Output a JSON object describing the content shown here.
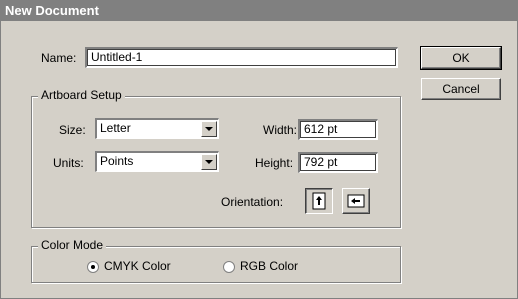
{
  "window": {
    "title": "New Document"
  },
  "name_field": {
    "label": "Name:",
    "value": "Untitled-1"
  },
  "buttons": {
    "ok": "OK",
    "cancel": "Cancel"
  },
  "artboard": {
    "legend": "Artboard Setup",
    "size_label": "Size:",
    "size_value": "Letter",
    "units_label": "Units:",
    "units_value": "Points",
    "width_label": "Width:",
    "width_value": "612 pt",
    "height_label": "Height:",
    "height_value": "792 pt",
    "orientation_label": "Orientation:"
  },
  "color_mode": {
    "legend": "Color Mode",
    "options": [
      "CMYK Color",
      "RGB Color"
    ],
    "selected": "CMYK Color"
  },
  "icons": [
    "portrait-orientation-icon",
    "landscape-orientation-icon",
    "dropdown-arrow-icon"
  ]
}
